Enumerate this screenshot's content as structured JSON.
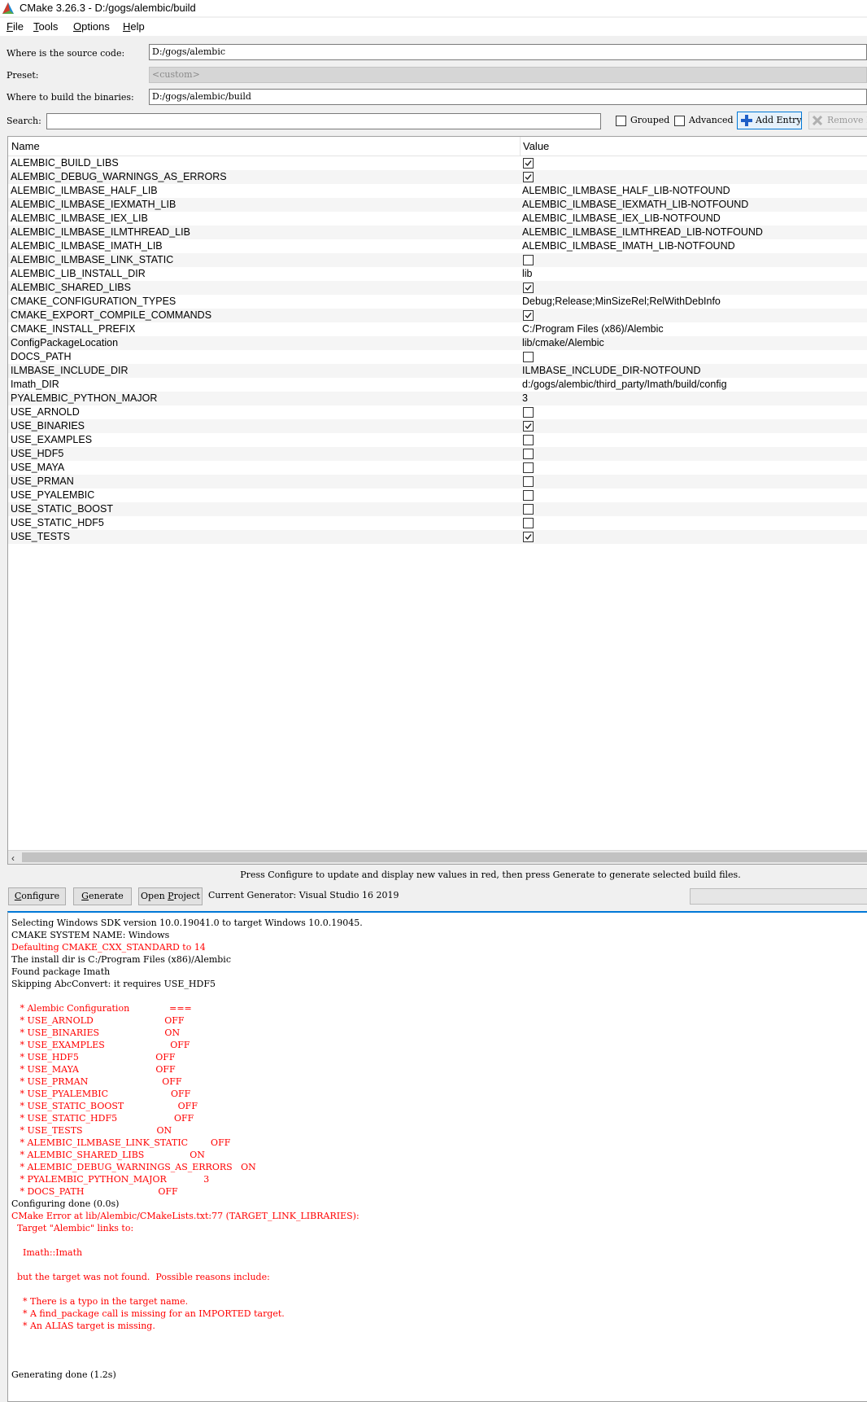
{
  "window": {
    "title": "CMake 3.26.3 - D:/gogs/alembic/build"
  },
  "menu": [
    {
      "label": "File",
      "u": "F",
      "rest": "ile"
    },
    {
      "label": "Tools",
      "u": "T",
      "rest": "ools"
    },
    {
      "label": "Options",
      "u": "O",
      "rest": "ptions"
    },
    {
      "label": "Help",
      "u": "H",
      "rest": "elp"
    }
  ],
  "source": {
    "label": "Where is the source code:",
    "value": "D:/gogs/alembic"
  },
  "preset": {
    "label": "Preset:",
    "value": "<custom>"
  },
  "binaries": {
    "label": "Where to build the binaries:",
    "value": "D:/gogs/alembic/build"
  },
  "search": {
    "label": "Search:",
    "value": ""
  },
  "toolbar": {
    "grouped_label": "Grouped",
    "grouped_checked": false,
    "advanced_label": "Advanced",
    "advanced_checked": false,
    "add_entry_label": "Add Entry",
    "remove_entry_label": "Remove Entry"
  },
  "table": {
    "columns": [
      "Name",
      "Value"
    ],
    "rows": [
      {
        "name": "ALEMBIC_BUILD_LIBS",
        "type": "bool",
        "checked": true
      },
      {
        "name": "ALEMBIC_DEBUG_WARNINGS_AS_ERRORS",
        "type": "bool",
        "checked": true
      },
      {
        "name": "ALEMBIC_ILMBASE_HALF_LIB",
        "type": "text",
        "value": "ALEMBIC_ILMBASE_HALF_LIB-NOTFOUND"
      },
      {
        "name": "ALEMBIC_ILMBASE_IEXMATH_LIB",
        "type": "text",
        "value": "ALEMBIC_ILMBASE_IEXMATH_LIB-NOTFOUND"
      },
      {
        "name": "ALEMBIC_ILMBASE_IEX_LIB",
        "type": "text",
        "value": "ALEMBIC_ILMBASE_IEX_LIB-NOTFOUND"
      },
      {
        "name": "ALEMBIC_ILMBASE_ILMTHREAD_LIB",
        "type": "text",
        "value": "ALEMBIC_ILMBASE_ILMTHREAD_LIB-NOTFOUND"
      },
      {
        "name": "ALEMBIC_ILMBASE_IMATH_LIB",
        "type": "text",
        "value": "ALEMBIC_ILMBASE_IMATH_LIB-NOTFOUND"
      },
      {
        "name": "ALEMBIC_ILMBASE_LINK_STATIC",
        "type": "bool",
        "checked": false
      },
      {
        "name": "ALEMBIC_LIB_INSTALL_DIR",
        "type": "text",
        "value": "lib"
      },
      {
        "name": "ALEMBIC_SHARED_LIBS",
        "type": "bool",
        "checked": true
      },
      {
        "name": "CMAKE_CONFIGURATION_TYPES",
        "type": "text",
        "value": "Debug;Release;MinSizeRel;RelWithDebInfo"
      },
      {
        "name": "CMAKE_EXPORT_COMPILE_COMMANDS",
        "type": "bool",
        "checked": true
      },
      {
        "name": "CMAKE_INSTALL_PREFIX",
        "type": "text",
        "value": "C:/Program Files (x86)/Alembic"
      },
      {
        "name": "ConfigPackageLocation",
        "type": "text",
        "value": "lib/cmake/Alembic"
      },
      {
        "name": "DOCS_PATH",
        "type": "bool",
        "checked": false
      },
      {
        "name": "ILMBASE_INCLUDE_DIR",
        "type": "text",
        "value": "ILMBASE_INCLUDE_DIR-NOTFOUND"
      },
      {
        "name": "Imath_DIR",
        "type": "text",
        "value": "d:/gogs/alembic/third_party/Imath/build/config"
      },
      {
        "name": "PYALEMBIC_PYTHON_MAJOR",
        "type": "text",
        "value": "3"
      },
      {
        "name": "USE_ARNOLD",
        "type": "bool",
        "checked": false
      },
      {
        "name": "USE_BINARIES",
        "type": "bool",
        "checked": true
      },
      {
        "name": "USE_EXAMPLES",
        "type": "bool",
        "checked": false
      },
      {
        "name": "USE_HDF5",
        "type": "bool",
        "checked": false
      },
      {
        "name": "USE_MAYA",
        "type": "bool",
        "checked": false
      },
      {
        "name": "USE_PRMAN",
        "type": "bool",
        "checked": false
      },
      {
        "name": "USE_PYALEMBIC",
        "type": "bool",
        "checked": false
      },
      {
        "name": "USE_STATIC_BOOST",
        "type": "bool",
        "checked": false
      },
      {
        "name": "USE_STATIC_HDF5",
        "type": "bool",
        "checked": false
      },
      {
        "name": "USE_TESTS",
        "type": "bool",
        "checked": true
      }
    ]
  },
  "status_message": "Press Configure to update and display new values in red, then press Generate to generate selected build files.",
  "buttons": {
    "configure": {
      "label": "Configure",
      "u": "C",
      "rest": "onfigure"
    },
    "generate": {
      "label": "Generate",
      "u": "G",
      "rest": "enerate"
    },
    "open_project": {
      "label": "Open Project",
      "pre": "Open ",
      "u": "P",
      "rest": "roject"
    }
  },
  "generator": "Current Generator: Visual Studio 16 2019",
  "log": [
    {
      "text": "Selecting Windows SDK version 10.0.19041.0 to target Windows 10.0.19045.",
      "red": false
    },
    {
      "text": "CMAKE SYSTEM NAME: Windows",
      "red": false
    },
    {
      "text": "Defaulting CMAKE_CXX_STANDARD to 14",
      "red": true
    },
    {
      "text": "The install dir is C:/Program Files (x86)/Alembic",
      "red": false
    },
    {
      "text": "Found package Imath",
      "red": false
    },
    {
      "text": "Skipping AbcConvert: it requires USE_HDF5",
      "red": false
    },
    {
      "text": "",
      "red": false
    },
    {
      "text": "   * Alembic Configuration              ===",
      "red": true
    },
    {
      "text": "   * USE_ARNOLD                         OFF",
      "red": true
    },
    {
      "text": "   * USE_BINARIES                       ON",
      "red": true
    },
    {
      "text": "   * USE_EXAMPLES                       OFF",
      "red": true
    },
    {
      "text": "   * USE_HDF5                           OFF",
      "red": true
    },
    {
      "text": "   * USE_MAYA                           OFF",
      "red": true
    },
    {
      "text": "   * USE_PRMAN                          OFF",
      "red": true
    },
    {
      "text": "   * USE_PYALEMBIC                      OFF",
      "red": true
    },
    {
      "text": "   * USE_STATIC_BOOST                   OFF",
      "red": true
    },
    {
      "text": "   * USE_STATIC_HDF5                    OFF",
      "red": true
    },
    {
      "text": "   * USE_TESTS                          ON",
      "red": true
    },
    {
      "text": "   * ALEMBIC_ILMBASE_LINK_STATIC        OFF",
      "red": true
    },
    {
      "text": "   * ALEMBIC_SHARED_LIBS                ON",
      "red": true
    },
    {
      "text": "   * ALEMBIC_DEBUG_WARNINGS_AS_ERRORS   ON",
      "red": true
    },
    {
      "text": "   * PYALEMBIC_PYTHON_MAJOR             3",
      "red": true
    },
    {
      "text": "   * DOCS_PATH                          OFF",
      "red": true
    },
    {
      "text": "Configuring done (0.0s)",
      "red": false
    },
    {
      "text": "CMake Error at lib/Alembic/CMakeLists.txt:77 (TARGET_LINK_LIBRARIES):",
      "red": true
    },
    {
      "text": "  Target \"Alembic\" links to:",
      "red": true
    },
    {
      "text": "",
      "red": false
    },
    {
      "text": "    Imath::Imath",
      "red": true
    },
    {
      "text": "",
      "red": false
    },
    {
      "text": "  but the target was not found.  Possible reasons include:",
      "red": true
    },
    {
      "text": "",
      "red": false
    },
    {
      "text": "    * There is a typo in the target name.",
      "red": true
    },
    {
      "text": "    * A find_package call is missing for an IMPORTED target.",
      "red": true
    },
    {
      "text": "    * An ALIAS target is missing.",
      "red": true
    },
    {
      "text": "",
      "red": false
    },
    {
      "text": "",
      "red": false
    },
    {
      "text": "",
      "red": false
    },
    {
      "text": "Generating done (1.2s)",
      "red": false
    }
  ],
  "colors": {
    "accent": "#0078d7",
    "error": "#ff0000",
    "alt_row": "#f5f5f5"
  }
}
